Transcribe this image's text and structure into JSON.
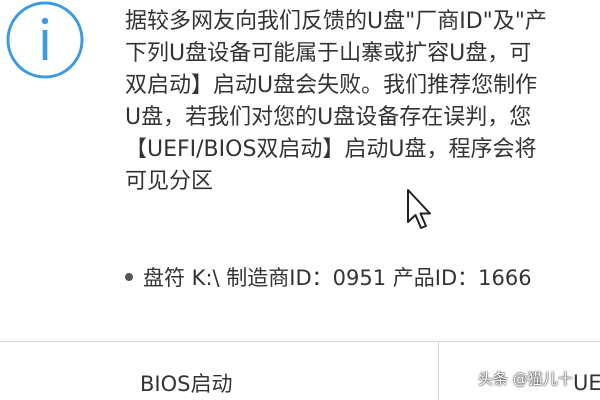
{
  "dialog": {
    "icon": "info-icon",
    "accent_color": "#3c9be0",
    "message_lines": [
      "据较多网友向我们反馈的U盘\"厂商ID\"及\"产",
      "下列U盘设备可能属于山寨或扩容U盘，可",
      "双启动】启动U盘会失败。我们推荐您制作",
      "U盘，若我们对您的U盘设备存在误判，您",
      "【UEFI/BIOS双启动】启动U盘，程序会将",
      "可见分区"
    ],
    "device_info": "盘符 K:\\ 制造商ID：0951 产品ID：1666",
    "buttons": {
      "bios": "BIOS启动",
      "uefi": "UEFI"
    }
  },
  "watermark": "头条 @猫儿十"
}
